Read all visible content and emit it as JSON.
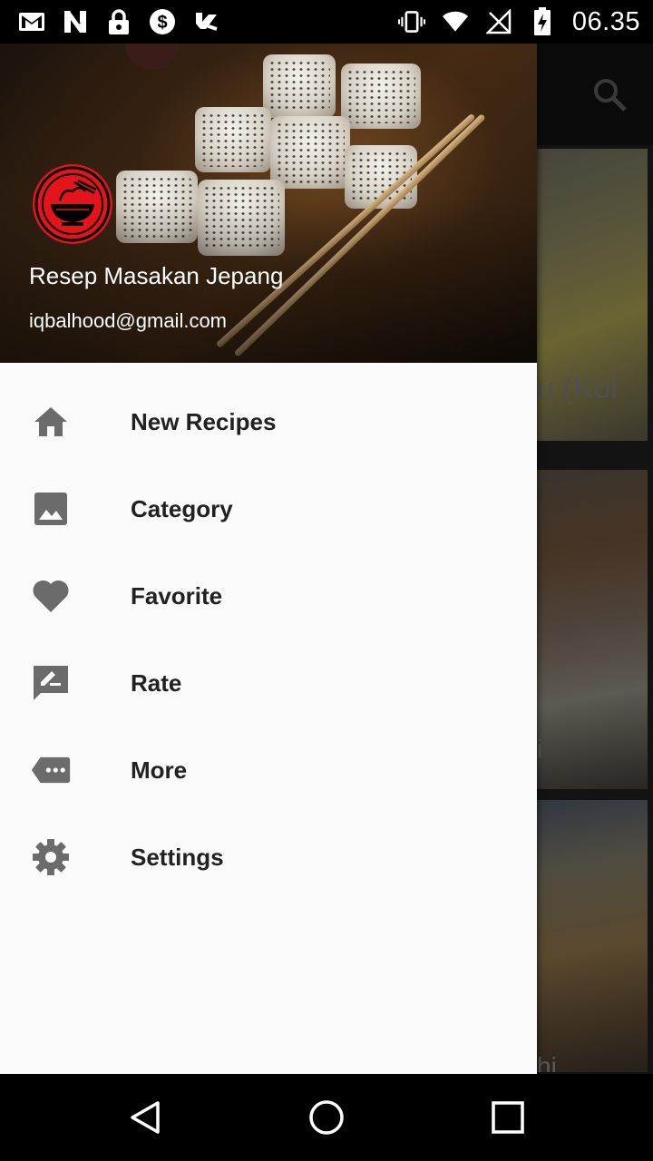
{
  "status_bar": {
    "time": "06.35",
    "left_icons": [
      "gmail-icon",
      "n-app-icon",
      "lock-icon",
      "dollar-icon",
      "check-app-icon"
    ],
    "right_icons": [
      "vibrate-icon",
      "wifi-icon",
      "no-signal-icon",
      "battery-charging-icon"
    ]
  },
  "drawer": {
    "header": {
      "app_name": "Resep Masakan Jepang",
      "email": "iqbalhood@gmail.com"
    },
    "menu": [
      {
        "label": "New Recipes",
        "icon": "home-icon"
      },
      {
        "label": "Category",
        "icon": "image-icon"
      },
      {
        "label": "Favorite",
        "icon": "heart-icon"
      },
      {
        "label": "Rate",
        "icon": "rate-review-icon"
      },
      {
        "label": "More",
        "icon": "more-tag-icon"
      },
      {
        "label": "Settings",
        "icon": "settings-icon"
      }
    ]
  },
  "background": {
    "cards": [
      {
        "title_fragment": "u (Kol"
      },
      {
        "title_fragment": "i"
      },
      {
        "title_fragment": "hi"
      }
    ]
  },
  "colors": {
    "drawer_bg": "#fafafa",
    "logo_red": "#e3151b",
    "menu_text": "#212121",
    "menu_icon": "#6b6b6b"
  }
}
